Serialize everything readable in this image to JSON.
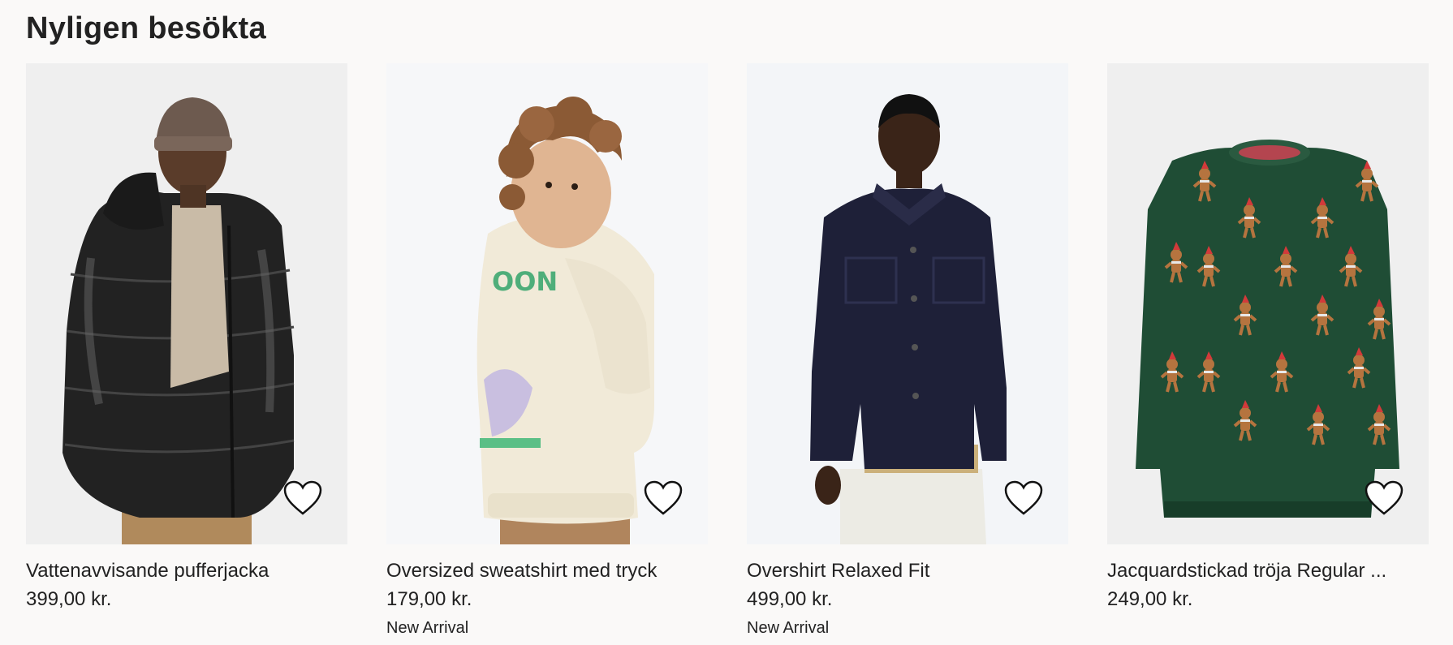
{
  "section": {
    "title": "Nyligen besökta"
  },
  "products": [
    {
      "name": "Vattenavvisande pufferjacka",
      "price": "399,00 kr.",
      "tag": "",
      "image": "black-puffer-jacket-model",
      "favorite_icon": "heart-outline-icon"
    },
    {
      "name": "Oversized sweatshirt med tryck",
      "price": "179,00 kr.",
      "tag": "New Arrival",
      "image": "kids-cream-sweatshirt-model",
      "favorite_icon": "heart-outline-icon"
    },
    {
      "name": "Overshirt Relaxed Fit",
      "price": "499,00 kr.",
      "tag": "New Arrival",
      "image": "navy-overshirt-model",
      "favorite_icon": "heart-outline-icon"
    },
    {
      "name": "Jacquardstickad tröja Regular ...",
      "price": "249,00 kr.",
      "tag": "",
      "image": "green-gingerbread-sweater",
      "favorite_icon": "heart-outline-icon"
    }
  ],
  "colors": {
    "background": "#faf9f8",
    "text": "#222222",
    "image_background": "#f2f2f1"
  }
}
